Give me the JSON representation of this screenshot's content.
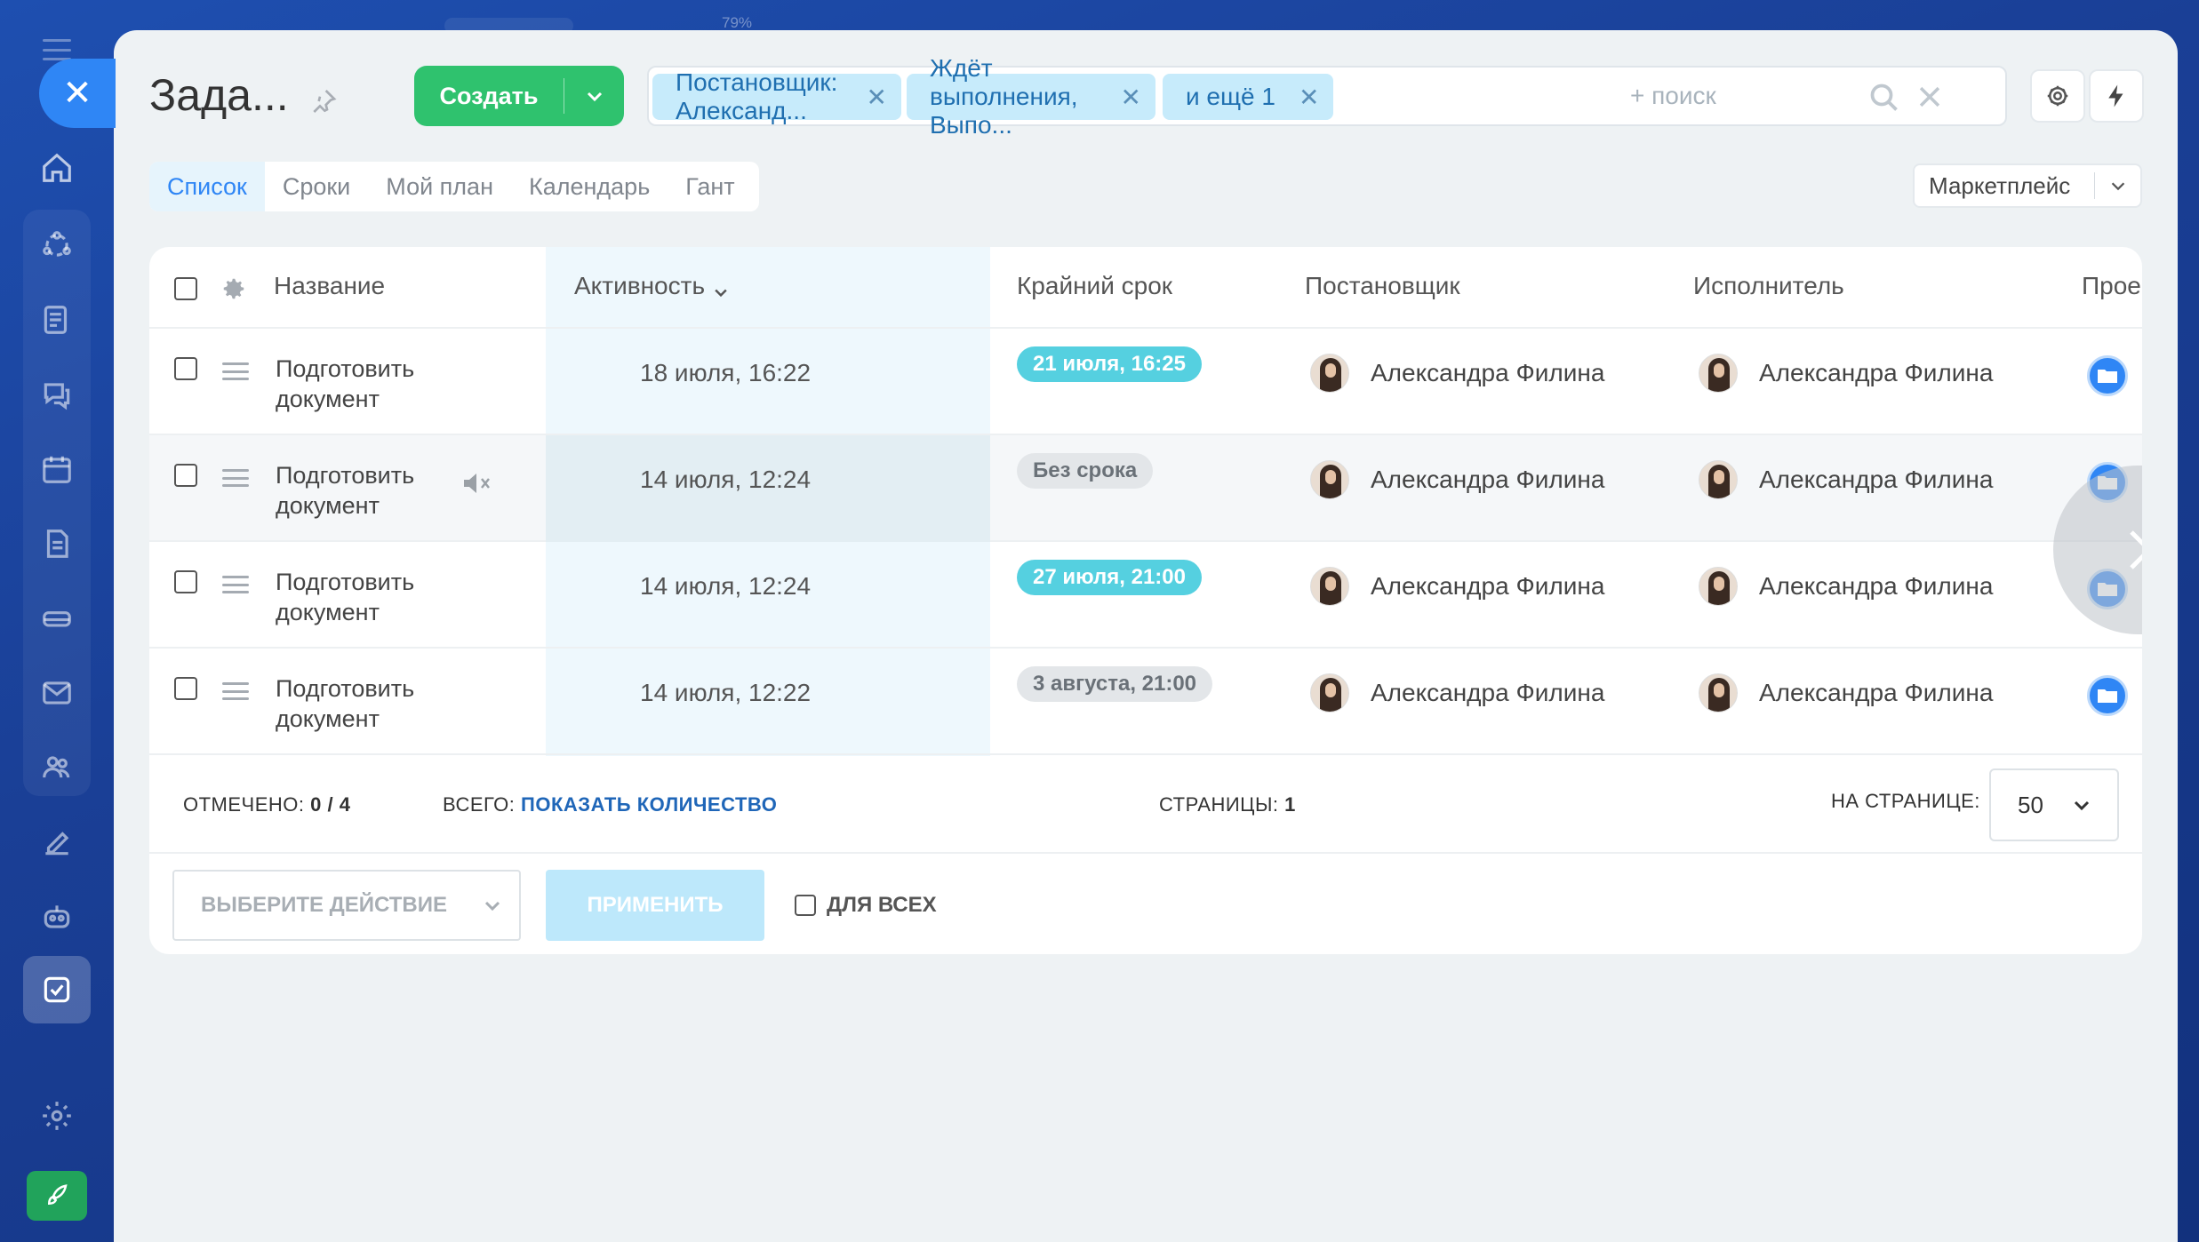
{
  "page": {
    "title": "Зада...",
    "zoom": "79%",
    "create_label": "Создать",
    "search_placeholder": "+ поиск"
  },
  "filters": [
    {
      "label": "Постановщик: Александ..."
    },
    {
      "label": "Ждёт выполнения, Выпо..."
    },
    {
      "label": "и ещё 1"
    }
  ],
  "tabs": [
    {
      "label": "Список",
      "active": true
    },
    {
      "label": "Сроки",
      "active": false
    },
    {
      "label": "Мой план",
      "active": false
    },
    {
      "label": "Календарь",
      "active": false
    },
    {
      "label": "Гант",
      "active": false
    }
  ],
  "marketplace_label": "Маркетплейс",
  "columns": {
    "name": "Название",
    "activity": "Активность",
    "deadline": "Крайний срок",
    "creator": "Постановщик",
    "assignee": "Исполнитель",
    "project": "Прое"
  },
  "rows": [
    {
      "name": "Подготовить документ",
      "activity": "18 июля, 16:22",
      "deadline": "21 июля, 16:25",
      "deadline_style": "blue",
      "creator": "Александра Филина",
      "assignee": "Александра Филина",
      "muted": false
    },
    {
      "name": "Подготовить документ",
      "activity": "14 июля, 12:24",
      "deadline": "Без срока",
      "deadline_style": "gray",
      "creator": "Александра Филина",
      "assignee": "Александра Филина",
      "muted": true
    },
    {
      "name": "Подготовить документ",
      "activity": "14 июля, 12:24",
      "deadline": "27 июля, 21:00",
      "deadline_style": "blue",
      "creator": "Александра Филина",
      "assignee": "Александра Филина",
      "muted": false
    },
    {
      "name": "Подготовить документ",
      "activity": "14 июля, 12:22",
      "deadline": "3 августа, 21:00",
      "deadline_style": "gray",
      "creator": "Александра Филина",
      "assignee": "Александра Филина",
      "muted": false
    }
  ],
  "footer": {
    "selected_label": "ОТМЕЧЕНО:",
    "selected_value": "0 / 4",
    "total_label": "ВСЕГО:",
    "total_link": "ПОКАЗАТЬ КОЛИЧЕСТВО",
    "pages_label": "СТРАНИЦЫ:",
    "pages_value": "1",
    "per_page_label": "НА СТРАНИЦЕ:",
    "per_page_value": "50"
  },
  "bulk": {
    "select_placeholder": "ВЫБЕРИТЕ ДЕЙСТВИЕ",
    "apply_label": "ПРИМЕНИТЬ",
    "for_all_label": "ДЛЯ ВСЕХ"
  },
  "colors": {
    "create": "#2fc26e",
    "accent": "#2f86f5",
    "deadline_blue": "#55d0e0",
    "deadline_gray": "#e3e6e9"
  }
}
